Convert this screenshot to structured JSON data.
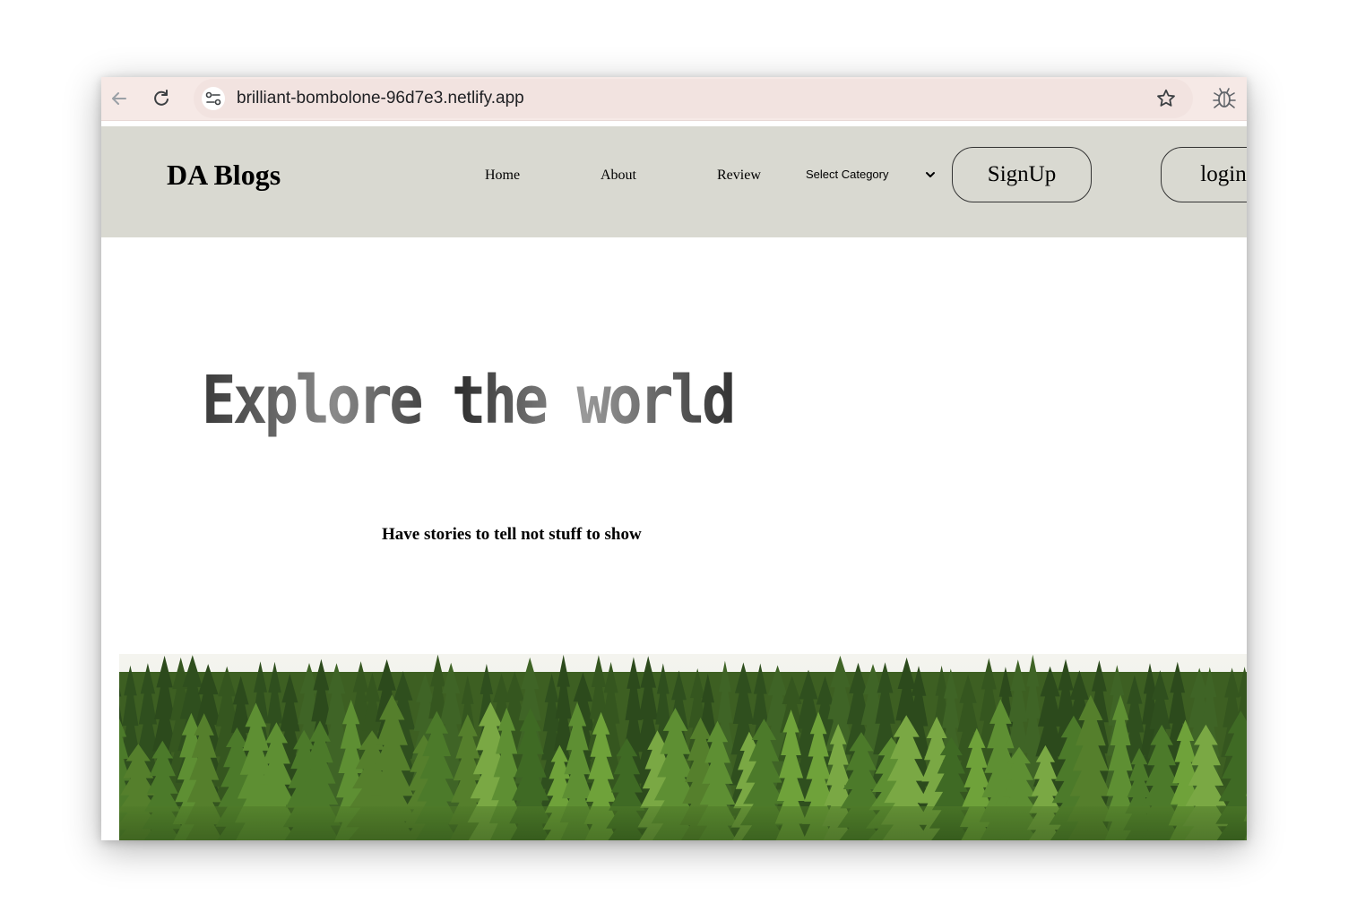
{
  "browser": {
    "url": "brilliant-bombolone-96d7e3.netlify.app",
    "icons": {
      "back": "arrow-left-icon",
      "reload": "reload-icon",
      "site_info": "tune-icon",
      "bookmark": "star-icon",
      "extension": "bug-extension-icon"
    }
  },
  "header": {
    "brand": "DA Blogs",
    "nav": {
      "home": "Home",
      "about": "About",
      "review": "Review"
    },
    "category_select": {
      "selected": "Select Category"
    },
    "signup_label": "SignUp",
    "login_label": "login",
    "background": "#d9d9d1"
  },
  "hero": {
    "title": "Explore the world",
    "tagline": "Have stories to tell not stuff to show",
    "image": "forest-photo"
  }
}
